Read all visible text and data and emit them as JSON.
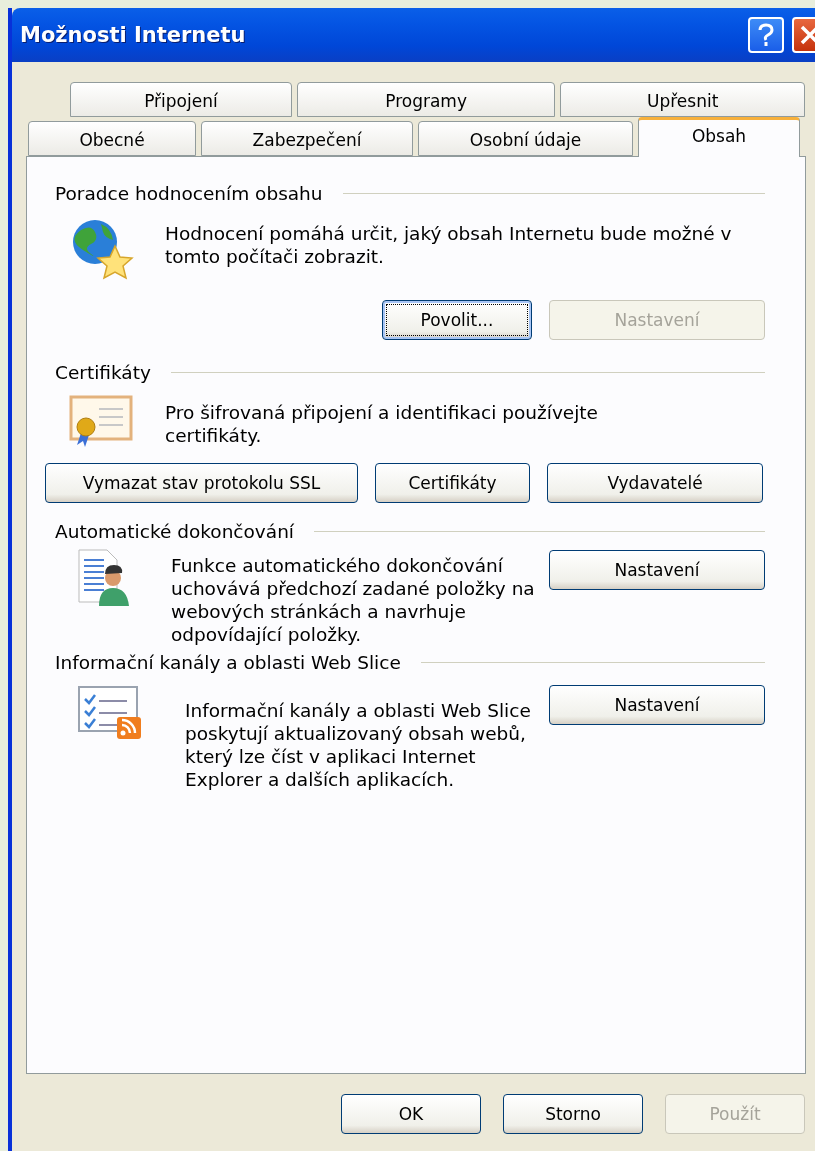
{
  "window": {
    "title": "Možnosti Internetu"
  },
  "tab_rows": [
    {
      "tabs": [
        {
          "label": "Připojení",
          "selected": false
        },
        {
          "label": "Programy",
          "selected": false
        },
        {
          "label": "Upřesnit",
          "selected": false
        }
      ]
    },
    {
      "tabs": [
        {
          "label": "Obecné",
          "selected": false
        },
        {
          "label": "Zabezpečení",
          "selected": false
        },
        {
          "label": "Osobní údaje",
          "selected": false
        },
        {
          "label": "Obsah",
          "selected": true
        }
      ]
    }
  ],
  "sections": [
    {
      "title": "Poradce hodnocením obsahu",
      "kind": "rating",
      "description": "Hodnocení pomáhá určit, jaký obsah Internetu bude možné v tomto počítači zobrazit.",
      "buttons": [
        {
          "label": "Povolit...",
          "disabled": false,
          "focused": true
        },
        {
          "label": "Nastavení",
          "disabled": true,
          "focused": false
        }
      ]
    },
    {
      "title": "Certifikáty",
      "kind": "certificates",
      "description": "Pro šifrovaná připojení a identifikaci používejte certifikáty.",
      "buttons": [
        {
          "label": "Vymazat stav protokolu SSL",
          "disabled": false,
          "focused": false
        },
        {
          "label": "Certifikáty",
          "disabled": false,
          "focused": false
        },
        {
          "label": "Vydavatelé",
          "disabled": false,
          "focused": false
        }
      ]
    },
    {
      "title": "Automatické dokončování",
      "kind": "autocomplete",
      "description": "Funkce automatického dokončování uchovává předchozí zadané položky na webových stránkách a navrhuje odpovídající položky.",
      "buttons": [
        {
          "label": "Nastavení",
          "disabled": false,
          "focused": false
        }
      ]
    },
    {
      "title": "Informační kanály a oblasti Web Slice",
      "kind": "feeds",
      "description": "Informační kanály a oblasti Web Slice poskytují aktualizovaný obsah webů, který lze číst v aplikaci Internet Explorer a dalších aplikacích.",
      "buttons": [
        {
          "label": "Nastavení",
          "disabled": false,
          "focused": false
        }
      ]
    }
  ],
  "dialog_buttons": [
    {
      "label": "OK",
      "disabled": false,
      "focused": false
    },
    {
      "label": "Storno",
      "disabled": false,
      "focused": false
    },
    {
      "label": "Použít",
      "disabled": true,
      "focused": false
    }
  ]
}
